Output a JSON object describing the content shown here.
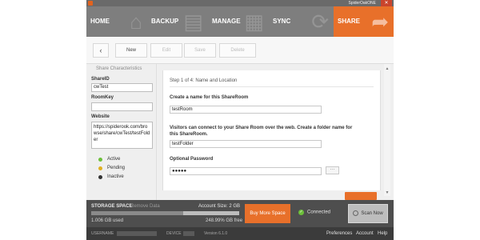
{
  "app": {
    "title": "SpiderOakONE",
    "close_glyph": "✕"
  },
  "nav": {
    "home": "HOME",
    "backup": "BACKUP",
    "manage": "MANAGE",
    "sync": "SYNC",
    "share": "SHARE",
    "active": "share"
  },
  "toolbar": {
    "back_glyph": "‹",
    "new_label": "New",
    "edit_label": "Edit",
    "save_label": "Save",
    "delete_label": "Delete"
  },
  "sidebar": {
    "heading": "Share Characteristics",
    "shareid_label": "ShareID",
    "shareid_value": "cwTest",
    "roomkey_label": "RoomKey",
    "roomkey_value": "",
    "website_label": "Website",
    "website_value": "https://spiderook.com/browse/share/cwTest/testFolder",
    "statuses": [
      {
        "label": "Active",
        "color": "#6cbf3a"
      },
      {
        "label": "Pending",
        "color": "#e0b020"
      },
      {
        "label": "Inactive",
        "color": "#333333"
      }
    ]
  },
  "form": {
    "step_title": "Step 1 of 4: Name and Location",
    "room_name_label": "Create a name for this ShareRoom",
    "room_name_value": "testRoom",
    "folder_label": "Visitors can connect to your Share Room over the web. Create a folder name for this ShareRoom.",
    "folder_value": "testFolder",
    "password_label": "Optional Password",
    "password_value": "●●●●●",
    "password_button": "···",
    "scroll_up": "▲",
    "scroll_down": "▼"
  },
  "storage": {
    "title": "STORAGE SPACE",
    "remove_data": "Remove Data",
    "account_size": "Account Size: 2 GB",
    "used": "1.006 GB used",
    "free": "248.99% GB free",
    "used_fraction": 0.62,
    "buy_button": "Buy More Space",
    "connected": "Connected",
    "scan_button": "Scan Now"
  },
  "statusbar": {
    "username_label": "USERNAME",
    "device_label": "DEVICE",
    "version": "Version 6.1.0",
    "preferences": "Preferences",
    "account": "Account",
    "help": "Help"
  },
  "colors": {
    "accent": "#e8702a",
    "nav_bg": "#7e7e7e",
    "footer_bg": "#4e4e4e"
  }
}
